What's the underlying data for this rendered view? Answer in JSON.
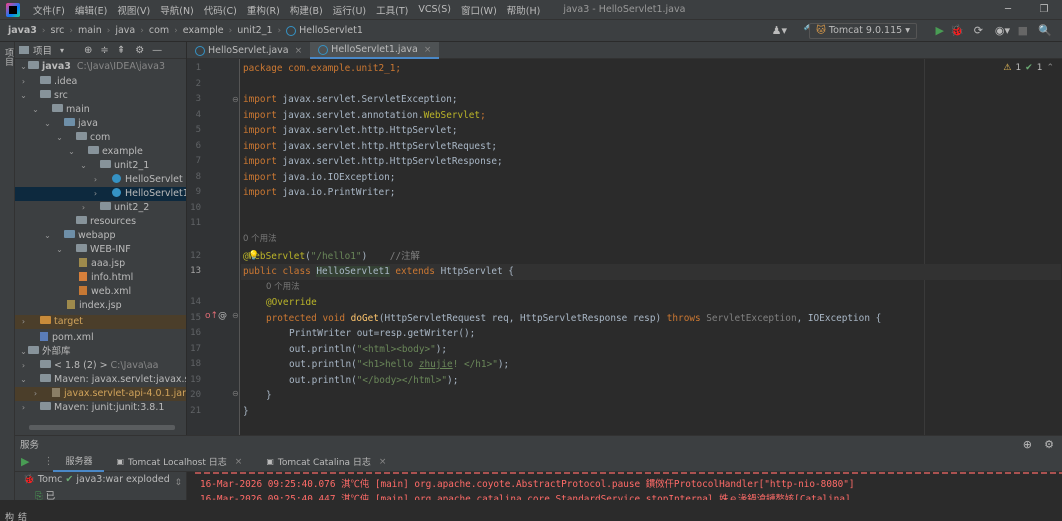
{
  "menu": [
    "文件(F)",
    "编辑(E)",
    "视图(V)",
    "导航(N)",
    "代码(C)",
    "重构(R)",
    "构建(B)",
    "运行(U)",
    "工具(T)",
    "VCS(S)",
    "窗口(W)",
    "帮助(H)"
  ],
  "window_title": "java3 - HelloServlet1.java",
  "breadcrumb": [
    "java3",
    "src",
    "main",
    "java",
    "com",
    "example",
    "unit2_1",
    "HelloServlet1"
  ],
  "run_config": "Tomcat 9.0.115",
  "project_panel": {
    "title": "项目",
    "root_name": "java3",
    "root_path": "C:\\Java\\IDEA\\java3",
    "items": [
      {
        "label": ".idea"
      },
      {
        "label": "src"
      },
      {
        "label": "main"
      },
      {
        "label": "java"
      },
      {
        "label": "com"
      },
      {
        "label": "example"
      },
      {
        "label": "unit2_1"
      },
      {
        "label": "HelloServlet"
      },
      {
        "label": "HelloServlet1"
      },
      {
        "label": "unit2_2"
      },
      {
        "label": "resources"
      },
      {
        "label": "webapp"
      },
      {
        "label": "WEB-INF"
      },
      {
        "label": "aaa.jsp"
      },
      {
        "label": "info.html"
      },
      {
        "label": "web.xml"
      },
      {
        "label": "index.jsp"
      },
      {
        "label": "target"
      },
      {
        "label": "pom.xml"
      },
      {
        "label": "外部库"
      },
      {
        "label": "< 1.8 (2) >",
        "extra": "C:\\Java\\aa"
      },
      {
        "label": "Maven: javax.servlet:javax.servlet-a"
      },
      {
        "label": "javax.servlet-api-4.0.1.jar",
        "extra": "library"
      },
      {
        "label": "Maven: junit:junit:3.8.1"
      }
    ]
  },
  "editor": {
    "tabs": [
      {
        "label": "HelloServlet.java",
        "close": "×"
      },
      {
        "label": "HelloServlet1.java",
        "close": "×"
      }
    ],
    "line_numbers": [
      "1",
      "2",
      "3",
      "4",
      "5",
      "6",
      "7",
      "8",
      "9",
      "10",
      "11",
      "12",
      "13",
      "14",
      "15",
      "16",
      "17",
      "18",
      "19",
      "20",
      "21"
    ],
    "usage_hint": "0 个用法",
    "inspections": {
      "warnings": "1",
      "ok": "1"
    },
    "code": {
      "l1": "package com.example.unit2_1;",
      "imp": "import",
      "i3": " javax.servlet.ServletException;",
      "i4a": " javax.servlet.annotation.",
      "i4b": "WebServlet",
      "i5": " javax.servlet.http.HttpServlet;",
      "i6": " javax.servlet.http.HttpServletRequest;",
      "i7": " javax.servlet.http.HttpServletResponse;",
      "i8": " java.io.IOException;",
      "i9": " java.io.PrintWriter;",
      "l12a": "@WebServlet",
      "l12b": "\"/hello1\"",
      "l12c": "//注解",
      "l13a": "public class ",
      "l13b": "HelloServlet1",
      "l13c": " extends ",
      "l13d": "HttpServlet {",
      "l14": "@Override",
      "l15a": "protected void ",
      "l15b": "doGet",
      "l15c": "(HttpServletRequest req, HttpServletResponse resp) ",
      "l15d": "throws ",
      "l15e": "ServletException",
      "l15f": ", IOException {",
      "l16": "PrintWriter out=resp.getWriter();",
      "l17a": "out.println(",
      "l17b": "\"<html><body>\"",
      "l17c": ");",
      "l18b1": "\"<h1>hello ",
      "l18b2": "zhujie",
      "l18b3": "! </h1>\"",
      "l19b": "\"</body></html>\"",
      "l20": "}",
      "l21": "}"
    }
  },
  "services": {
    "title": "服务",
    "tabs": [
      "服务器",
      "Tomcat Localhost 日志",
      "Tomcat Catalina 日志"
    ],
    "tree_item1_a": "Tomc",
    "tree_item1_b": "java3:war exploded",
    "tree_item2": "已",
    "log_lines": [
      "16-Mar-2026 09:25:40.076 淇℃伅 [main] org.apache.coyote.AbstractProtocol.pause 鏆傚仠ProtocolHandler[\"http-nio-8080\"]",
      "16-Mar-2026 09:25:40.447 淇℃伅 [main] org.apache.catalina.core.StandardService.stopInternal 姝ｅ湪鍋滄鏈嶅姟[Catalina]"
    ]
  },
  "colors": {
    "keyword": "#cc7832",
    "annotation": "#bbb529",
    "string": "#6a8759",
    "comment": "#808080",
    "method": "#ffc66d",
    "log_error": "#ff6b68",
    "selection": "#0d293e"
  }
}
